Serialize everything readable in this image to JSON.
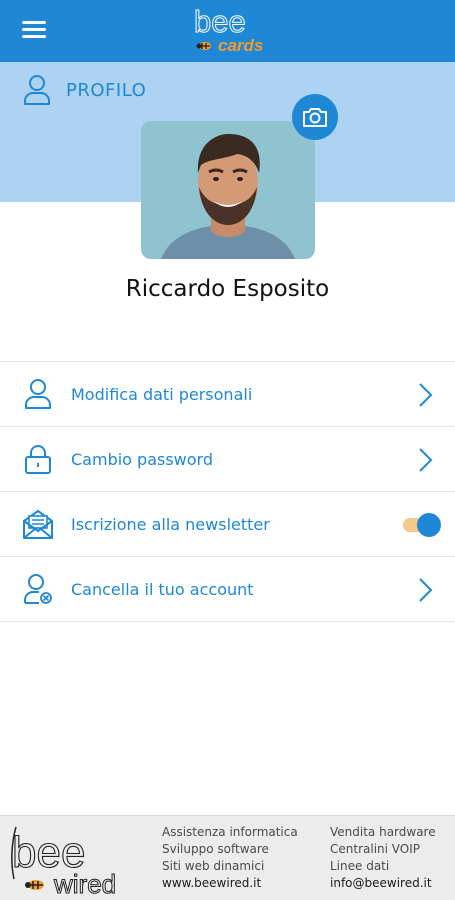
{
  "app": {
    "logo_top": "bee",
    "logo_bottom": "cards"
  },
  "colors": {
    "primary": "#1e88d6",
    "band": "#aed2f1",
    "accent": "#f39c2d"
  },
  "profile": {
    "section_label": "PROFILO",
    "user_name": "Riccardo Esposito",
    "icons": {
      "section": "user-icon",
      "photo_action": "camera-icon"
    }
  },
  "menu": {
    "items": [
      {
        "label": "Modifica dati personali",
        "icon": "user-icon",
        "action": "chevron-right-icon"
      },
      {
        "label": "Cambio password",
        "icon": "lock-icon",
        "action": "chevron-right-icon"
      },
      {
        "label": "Iscrizione alla newsletter",
        "icon": "newsletter-envelope-icon",
        "action": "toggle",
        "toggle_on": true
      },
      {
        "label": "Cancella il tuo account",
        "icon": "user-delete-icon",
        "action": "chevron-right-icon"
      }
    ]
  },
  "footer": {
    "logo_top": "bee",
    "logo_bottom": "wired",
    "col1": [
      "Assistenza informatica",
      "Sviluppo software",
      "Siti web dinamici",
      "www.beewired.it"
    ],
    "col2": [
      "Vendita hardware",
      "Centralini VOIP",
      "Linee dati",
      "info@beewired.it"
    ]
  }
}
